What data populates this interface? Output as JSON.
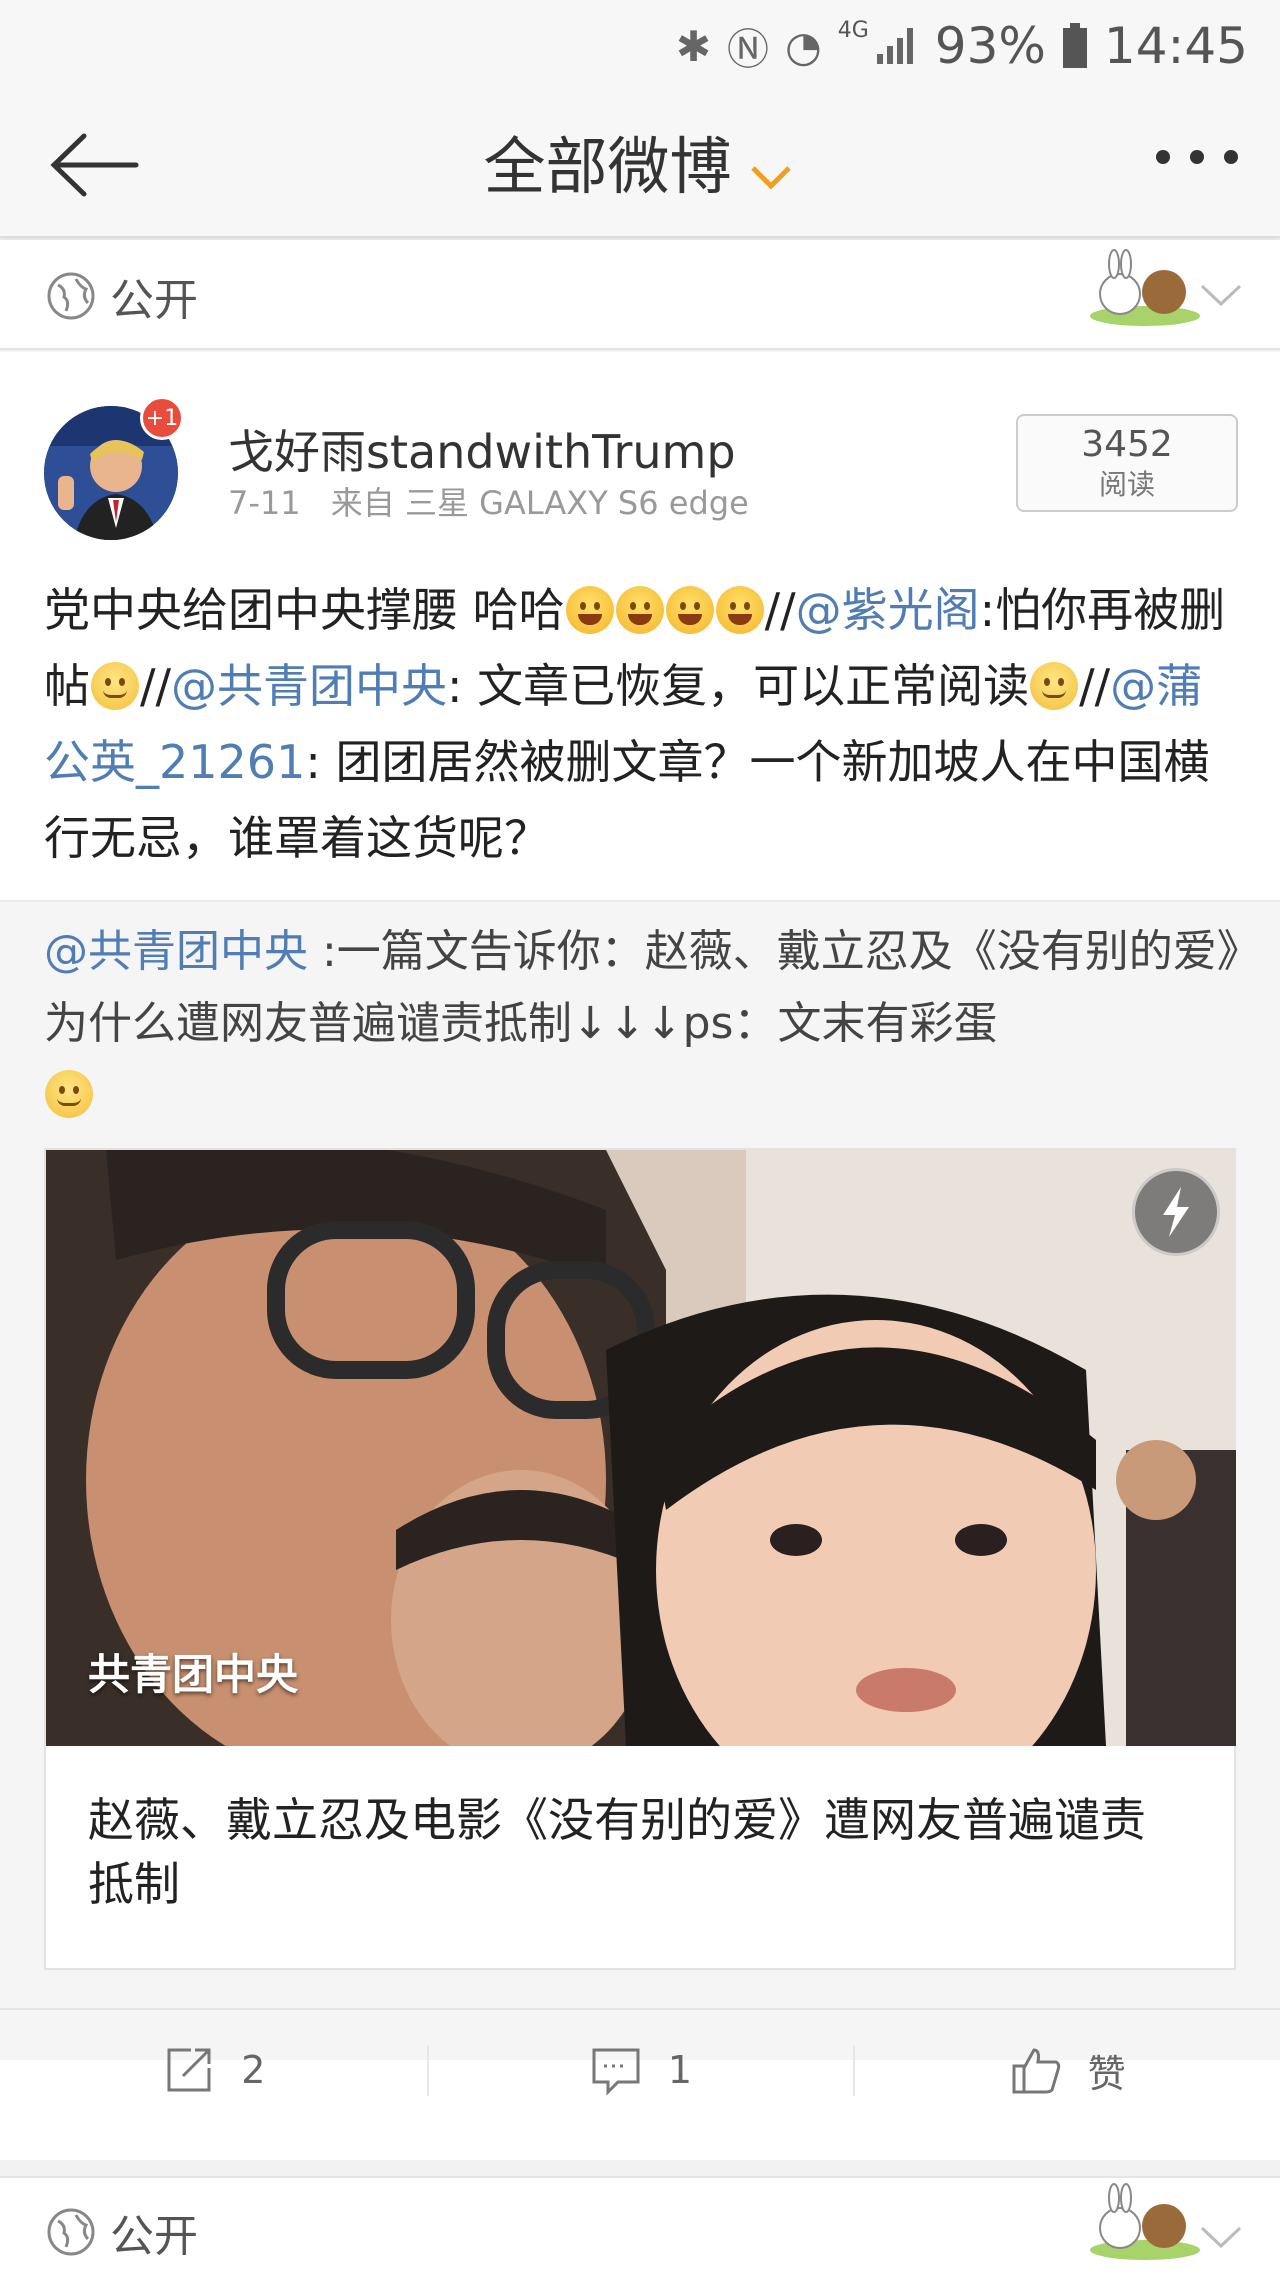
{
  "status_bar": {
    "battery": "93%",
    "time": "14:45",
    "network": "4G"
  },
  "nav": {
    "title": "全部微博"
  },
  "prev_card": {
    "visibility": "公开"
  },
  "post": {
    "avatar_badge": "+1",
    "username": "戈好雨standwithTrump",
    "date": "7-11",
    "source": "来自 三星 GALAXY S6 edge",
    "read_count": "3452",
    "read_label": "阅读",
    "text": {
      "p1": "党中央给团中央撑腰 哈哈",
      "p2": "//",
      "m1": "@紫光阁",
      "p3": ":怕你再被删帖",
      "p4": "//",
      "m2": "@共青团中央",
      "p5": ": 文章已恢复，可以正常阅读",
      "p6": "//",
      "m3": "@蒲公英_21261",
      "p7": ": 团团居然被删文章？一个新加坡人在中国横行无忌，谁罩着这货呢？"
    },
    "retweet": {
      "mention": "@共青团中央",
      "text": " :一篇文告诉你：赵薇、戴立忍及《没有别的爱》为什么遭网友普遍谴责抵制↓↓↓ps：文末有彩蛋"
    },
    "link_card": {
      "image_label": "共青团中央",
      "title": "赵薇、戴立忍及电影《没有别的爱》遭网友普遍谴责抵制"
    },
    "actions": {
      "repost_count": "2",
      "comment_count": "1",
      "like_label": "赞"
    }
  },
  "next_card": {
    "visibility": "公开"
  },
  "colors": {
    "mention": "#4f7db4",
    "caret": "#f0a020",
    "badge": "#e94b3c"
  }
}
